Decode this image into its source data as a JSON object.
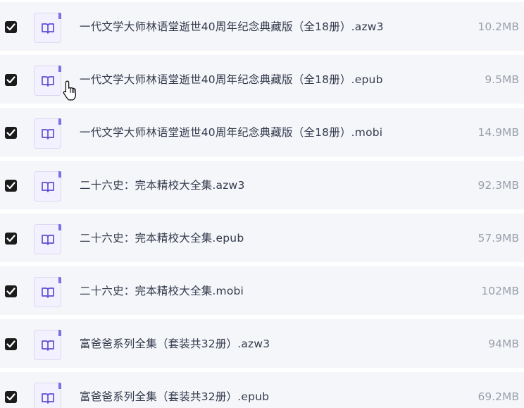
{
  "files": [
    {
      "name": "一代文学大师林语堂逝世40周年纪念典藏版（全18册）.azw3",
      "size": "10.2MB"
    },
    {
      "name": "一代文学大师林语堂逝世40周年纪念典藏版（全18册）.epub",
      "size": "9.5MB"
    },
    {
      "name": "一代文学大师林语堂逝世40周年纪念典藏版（全18册）.mobi",
      "size": "14.9MB"
    },
    {
      "name": "二十六史：完本精校大全集.azw3",
      "size": "92.3MB"
    },
    {
      "name": "二十六史：完本精校大全集.epub",
      "size": "57.9MB"
    },
    {
      "name": "二十六史：完本精校大全集.mobi",
      "size": "102MB"
    },
    {
      "name": "富爸爸系列全集（套装共32册）.azw3",
      "size": "94MB"
    },
    {
      "name": "富爸爸系列全集（套装共32册）.epub",
      "size": "69.2MB"
    }
  ]
}
